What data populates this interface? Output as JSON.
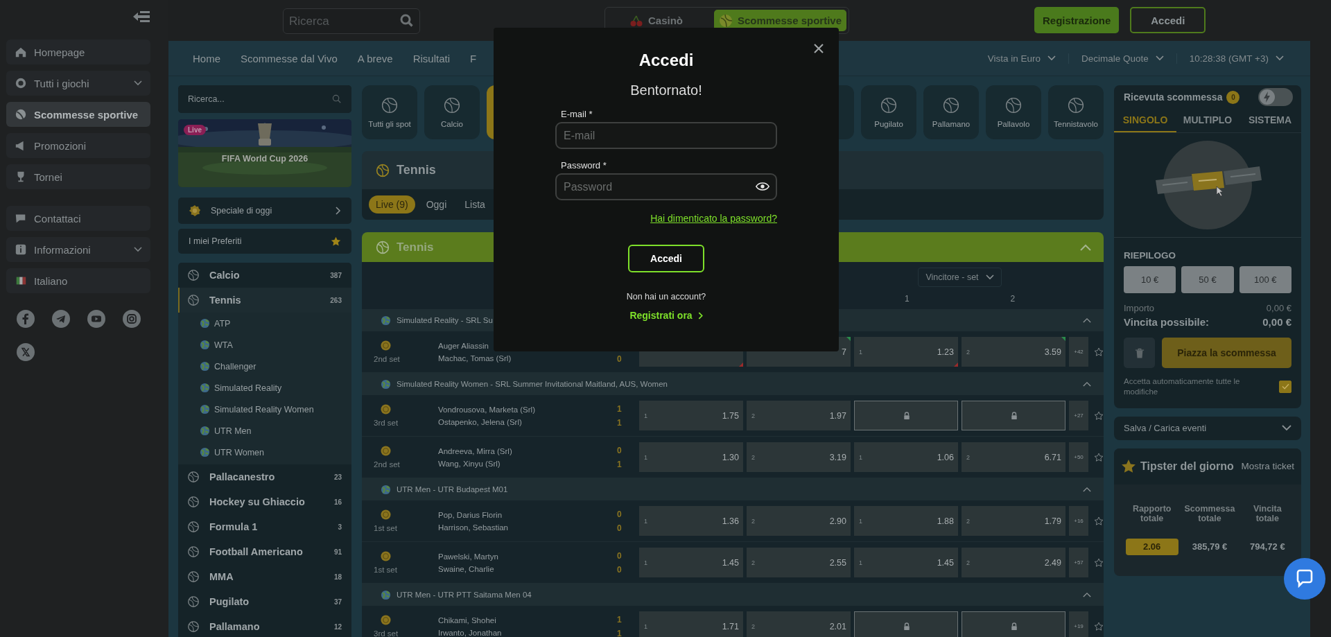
{
  "sidebar": {
    "groups": [
      {
        "items": [
          {
            "label": "Homepage",
            "selected": false,
            "has_submenu": false
          },
          {
            "label": "Tutti i giochi",
            "selected": false,
            "has_submenu": true
          },
          {
            "label": "Scommesse sportive",
            "selected": true,
            "has_submenu": false
          },
          {
            "label": "Promozioni",
            "selected": false,
            "has_submenu": false
          },
          {
            "label": "Tornei",
            "selected": false,
            "has_submenu": false
          }
        ]
      },
      {
        "items": [
          {
            "label": "Contattaci",
            "selected": false,
            "has_submenu": false
          },
          {
            "label": "Informazioni",
            "selected": false,
            "has_submenu": true
          },
          {
            "label": "Italiano",
            "selected": false,
            "has_submenu": false
          }
        ]
      }
    ]
  },
  "top_bar": {
    "search": {
      "placeholder": "Ricerca"
    },
    "modes": [
      {
        "label": "Casinò",
        "selected": false
      },
      {
        "label": "Scommesse sportive",
        "selected": true
      }
    ],
    "buttons": [
      {
        "label": "Registrazione",
        "kind": "primary"
      },
      {
        "label": "Accedi",
        "kind": "outline"
      }
    ]
  },
  "nav": {
    "items": [
      "Home",
      "Scommesse dal Vivo",
      "A breve",
      "Risultati",
      "F"
    ],
    "settings": [
      "Vista in Euro",
      "Decimale Quote",
      "10:28:38 (GMT +3)"
    ]
  },
  "left_panel": {
    "search": {
      "placeholder": "Ricerca..."
    },
    "banner": {
      "badge": "Live",
      "title": "FIFA World Cup 2026"
    },
    "special": "Speciale di oggi",
    "favorites": "I miei Preferiti",
    "sports": [
      {
        "name": "Calcio",
        "count": "387",
        "selected": false
      },
      {
        "name": "Tennis",
        "count": "263",
        "selected": true,
        "children": [
          {
            "name": "ATP"
          },
          {
            "name": "WTA"
          },
          {
            "name": "Challenger"
          },
          {
            "name": "Simulated Reality"
          },
          {
            "name": "Simulated Reality Women"
          },
          {
            "name": "UTR Men"
          },
          {
            "name": "UTR Women"
          }
        ]
      },
      {
        "name": "Pallacanestro",
        "count": "23",
        "selected": false
      },
      {
        "name": "Hockey su Ghiaccio",
        "count": "16",
        "selected": false
      },
      {
        "name": "Formula 1",
        "count": "3",
        "selected": false
      },
      {
        "name": "Football Americano",
        "count": "91",
        "selected": false
      },
      {
        "name": "MMA",
        "count": "18",
        "selected": false
      },
      {
        "name": "Pugilato",
        "count": "37",
        "selected": false
      },
      {
        "name": "Pallamano",
        "count": "12",
        "selected": false
      }
    ]
  },
  "sport_tiles": [
    {
      "label": "Tutti gli spot",
      "selected": false
    },
    {
      "label": "Calcio",
      "selected": false
    },
    {
      "selected": true
    },
    {
      "selected": false
    },
    {
      "label": "Pugilato",
      "selected": false
    },
    {
      "label": "Pallamano",
      "selected": false
    },
    {
      "label": "Pallavolo",
      "selected": false
    },
    {
      "label": "Tennistavolo",
      "selected": false
    }
  ],
  "event_header": {
    "title": "Tennis",
    "tabs": [
      {
        "label": "Live (9)",
        "selected": true
      },
      {
        "label": "Oggi",
        "selected": false
      },
      {
        "label": "Lista",
        "selected": false
      }
    ]
  },
  "events": {
    "title": "Tennis",
    "expanded": true,
    "market": "Vincitore - set",
    "columns": [
      "1",
      "2"
    ],
    "groups": [
      {
        "name": "Simulated Reality - SRL Su",
        "expanded": true,
        "matches": [
          {
            "period": "2nd set",
            "players": [
              {
                "name": "Auger Aliassin"
              },
              {
                "name": "Machac, Tomas (Srl)",
                "score": "0"
              }
            ],
            "odds": [
              {
                "kind": "odd",
                "rise": false
              },
              {
                "kind": "odd",
                "value": "7",
                "rise": true
              },
              {
                "kind": "odd",
                "label": "1",
                "value": "1.23",
                "rise": false
              },
              {
                "kind": "odd",
                "label": "2",
                "value": "3.59",
                "rise": true
              }
            ],
            "more": "+42"
          }
        ]
      },
      {
        "name": "Simulated Reality Women - SRL Summer Invitational Maitland, AUS, Women",
        "expanded": true,
        "matches": [
          {
            "period": "3rd set",
            "players": [
              {
                "name": "Vondrousova, Marketa (Srl)",
                "score": "1"
              },
              {
                "name": "Ostapenko, Jelena (Srl)",
                "score": "1"
              }
            ],
            "odds": [
              {
                "kind": "odd",
                "label": "1",
                "value": "1.75"
              },
              {
                "kind": "odd",
                "label": "2",
                "value": "1.97"
              },
              {
                "kind": "locked"
              },
              {
                "kind": "locked"
              }
            ],
            "more": "+27"
          },
          {
            "period": "2nd set",
            "players": [
              {
                "name": "Andreeva, Mirra (Srl)",
                "score": "0"
              },
              {
                "name": "Wang, Xinyu (Srl)",
                "score": "1"
              }
            ],
            "odds": [
              {
                "kind": "odd",
                "label": "1",
                "value": "1.30"
              },
              {
                "kind": "odd",
                "label": "2",
                "value": "3.19"
              },
              {
                "kind": "odd",
                "label": "1",
                "value": "1.06"
              },
              {
                "kind": "odd",
                "label": "2",
                "value": "6.71"
              }
            ],
            "more": "+50"
          }
        ]
      },
      {
        "name": "UTR Men - UTR Budapest M01",
        "expanded": true,
        "matches": [
          {
            "period": "1st set",
            "players": [
              {
                "name": "Pop, Darius Florin",
                "score": "0"
              },
              {
                "name": "Harrison, Sebastian",
                "score": "0"
              }
            ],
            "odds": [
              {
                "kind": "odd",
                "label": "1",
                "value": "1.36"
              },
              {
                "kind": "odd",
                "label": "2",
                "value": "2.90"
              },
              {
                "kind": "odd",
                "label": "1",
                "value": "1.88"
              },
              {
                "kind": "odd",
                "label": "2",
                "value": "1.79"
              }
            ],
            "more": "+16"
          },
          {
            "period": "1st set",
            "players": [
              {
                "name": "Pawelski, Martyn",
                "score": "0"
              },
              {
                "name": "Swaine, Charlie",
                "score": "0"
              }
            ],
            "odds": [
              {
                "kind": "odd",
                "label": "1",
                "value": "1.45"
              },
              {
                "kind": "odd",
                "label": "2",
                "value": "2.55"
              },
              {
                "kind": "odd",
                "label": "1",
                "value": "1.45"
              },
              {
                "kind": "odd",
                "label": "2",
                "value": "2.49"
              }
            ],
            "more": "+57"
          }
        ]
      },
      {
        "name": "UTR Men - UTR PTT Saitama Men 04",
        "expanded": true,
        "matches": [
          {
            "period": "3rd set",
            "players": [
              {
                "name": "Chikami, Shohei",
                "score": "1"
              },
              {
                "name": "Irwanto, Jonathan",
                "score": "1"
              }
            ],
            "odds": [
              {
                "kind": "odd",
                "label": "1",
                "value": "1.71"
              },
              {
                "kind": "odd",
                "label": "2",
                "value": "2.01"
              },
              {
                "kind": "locked"
              },
              {
                "kind": "locked"
              }
            ],
            "more": "+19"
          }
        ]
      }
    ]
  },
  "betslip": {
    "title": "Ricevuta scommessa",
    "count": "0",
    "quick_bet": false,
    "tabs": [
      {
        "label": "SINGOLO",
        "selected": true
      },
      {
        "label": "MULTIPLO",
        "selected": false
      },
      {
        "label": "SISTEMA",
        "selected": false
      }
    ],
    "summary_title": "RIEPILOGO",
    "stakes": [
      "10 €",
      "50 €",
      "100 €"
    ],
    "amount_label": "Importo",
    "amount": "0,00 €",
    "win_label": "Vincita possibile:",
    "win": "0,00 €",
    "place_button": {
      "label": "Piazza la scommessa",
      "disabled": true
    },
    "auto_accept": {
      "label": "Accetta automaticamente tutte le modifiche",
      "checked": true
    }
  },
  "save_load": {
    "label": "Salva / Carica eventi",
    "expanded": false
  },
  "tipster": {
    "title": "Tipster del giorno",
    "action": "Mostra ticket",
    "columns": [
      "Rapporto totale",
      "Scommessa totale",
      "Vincita totale"
    ],
    "values": [
      "2.06",
      "385,79 €",
      "794,72 €"
    ]
  },
  "modal": {
    "title": "Accedi",
    "subtitle": "Bentornato!",
    "fields": [
      {
        "label": "E-mail *",
        "placeholder": "E-mail",
        "kind": "text"
      },
      {
        "label": "Password *",
        "placeholder": "Password",
        "kind": "password"
      }
    ],
    "forgot": "Hai dimenticato la password?",
    "submit": "Accedi",
    "no_account": "Non hai un account?",
    "register": "Registrati ora"
  }
}
